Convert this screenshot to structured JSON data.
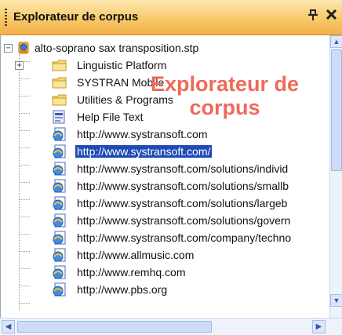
{
  "panel": {
    "title": "Explorateur de corpus",
    "pin_glyph": "ᵖ",
    "close_glyph": "×"
  },
  "tree": {
    "root": {
      "label": "alto-soprano sax transposition.stp",
      "expanded": true,
      "icon": "project-icon"
    },
    "items": [
      {
        "label": "Linguistic Platform",
        "icon": "folder-icon",
        "expandable": true
      },
      {
        "label": "SYSTRAN Mobile",
        "icon": "folder-icon",
        "expandable": false
      },
      {
        "label": "Utilities & Programs",
        "icon": "folder-icon",
        "expandable": false
      },
      {
        "label": "Help File Text",
        "icon": "document-icon",
        "expandable": false
      },
      {
        "label": "http://www.systransoft.com",
        "icon": "web-page-icon",
        "expandable": false
      },
      {
        "label": "http://www.systransoft.com/",
        "icon": "web-page-icon",
        "expandable": false,
        "selected": true
      },
      {
        "label": "http://www.systransoft.com/solutions/individ",
        "icon": "web-page-icon",
        "expandable": false
      },
      {
        "label": "http://www.systransoft.com/solutions/smallb",
        "icon": "web-page-icon",
        "expandable": false
      },
      {
        "label": "http://www.systransoft.com/solutions/largeb",
        "icon": "web-page-icon",
        "expandable": false
      },
      {
        "label": "http://www.systransoft.com/solutions/govern",
        "icon": "web-page-icon",
        "expandable": false
      },
      {
        "label": "http://www.systransoft.com/company/techno",
        "icon": "web-page-icon",
        "expandable": false
      },
      {
        "label": "http://www.allmusic.com",
        "icon": "web-page-icon",
        "expandable": false
      },
      {
        "label": "http://www.remhq.com",
        "icon": "web-page-icon",
        "expandable": false
      },
      {
        "label": "http://www.pbs.org",
        "icon": "web-page-icon",
        "expandable": false
      }
    ]
  },
  "overlay": {
    "line1": "Explorateur de",
    "line2": "corpus"
  },
  "colors": {
    "title_bar": "#f8c96a",
    "selection": "#1f4bb5",
    "overlay_text": "#f06a5a"
  }
}
